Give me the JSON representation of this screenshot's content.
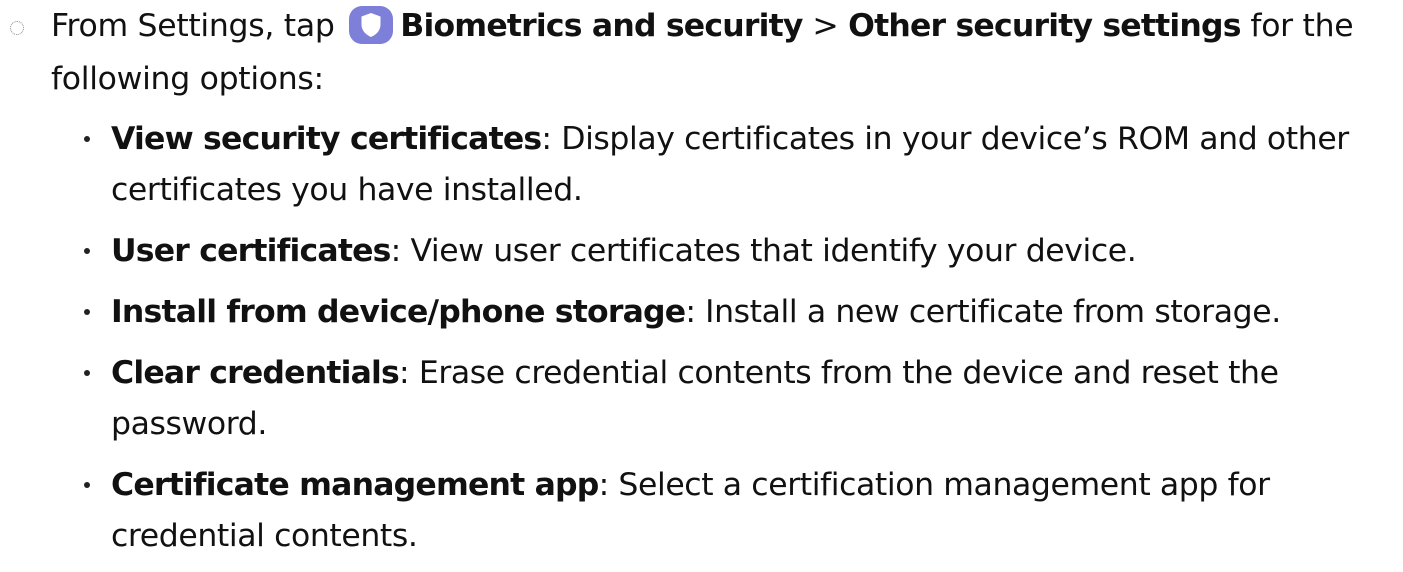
{
  "intro": {
    "prefix": "From Settings, tap",
    "menu_item": "Biometrics and security",
    "separator": ">",
    "submenu_item": "Other security settings",
    "suffix": "for the following options:",
    "icon": "shield-icon",
    "icon_color": "#7d7fd8"
  },
  "options": [
    {
      "term": "View security certificates",
      "desc": ": Display certificates in your device’s ROM and other certificates you have installed."
    },
    {
      "term": "User certificates",
      "desc": ": View user certificates that identify your device."
    },
    {
      "term": "Install from device/phone storage",
      "desc": ": Install a new certificate from storage."
    },
    {
      "term": "Clear credentials",
      "desc": ": Erase credential contents from the device and reset the password."
    },
    {
      "term": "Certificate management app",
      "desc": ": Select a certification management app for credential contents."
    }
  ]
}
